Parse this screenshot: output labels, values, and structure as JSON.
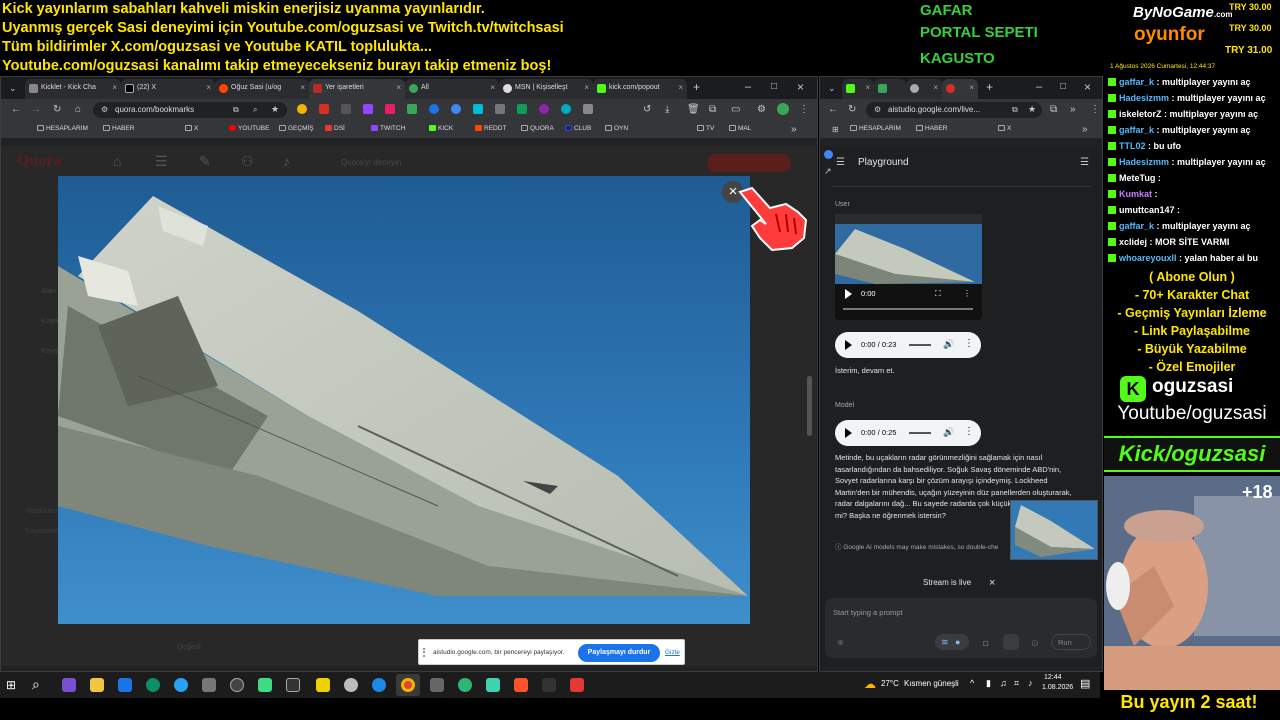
{
  "banner": {
    "lines": [
      "Kick yayınlarım sabahları kahveli miskin enerjisiz uyanma yayınlarıdır.",
      "Uyanmış gerçek Sasi deneyimi için Youtube.com/oguzsasi ve Twitch.tv/twitchsasi",
      "Tüm bildirimler X.com/oguzsasi ve Youtube KATIL toplulukta...",
      "Youtube.com/oguzsasi kanalımı takip etmeyecekseniz burayı takip etmeniz boş!"
    ],
    "goals": [
      "GAFAR",
      "PORTAL SEPETI",
      "KAGUSTO"
    ]
  },
  "donations": {
    "brand_top": "ByNoGame",
    "brand_domain": ".com",
    "brand_bottom": "oyunfor",
    "amounts": [
      "TRY 30.00",
      "TRY 30.00",
      "TRY 31.00"
    ],
    "date": "1 Ağustos 2026 Cumartesi, 12:44:37"
  },
  "left_browser": {
    "tabs": [
      "Kicklet - Kick Cha",
      "(22) X",
      "Oğuz Sasi (u/og",
      "Yer işaretleri",
      "All",
      "MSN | Kişiselleşt",
      "kick.com/popout"
    ],
    "url": "quora.com/bookmarks",
    "bookmarks": [
      "HESAPLARIM",
      "HABER",
      "X",
      "YOUTUBE",
      "GEÇMİŞ",
      "DSİ",
      "TWITCH",
      "KICK",
      "REDDT",
      "QUORA",
      "CLUB",
      "OYN",
      "TV",
      "MAL"
    ],
    "search_placeholder": "Quora'yı deneyin",
    "sidebar_items": [
      "Alan",
      "Koleksi",
      "Kaydedi",
      "Yazdıklarınız",
      "Kaydedildi"
    ],
    "footer_action": "Değerli"
  },
  "right_browser": {
    "url": "aistudio.google.com/live...",
    "bookmarks": [
      "HESAPLARIM",
      "HABER",
      "X"
    ],
    "title": "Playground",
    "user_label": "User",
    "video_time": "0:00",
    "audio1_time": "0:00 / 0:23",
    "user_message": "İsterim, devam et.",
    "model_label": "Model",
    "audio2_time": "0:00 / 0:25",
    "model_message": "Metinde, bu uçakların radar görünmezliğini sağlamak için nasıl tasarlandığından da bahsediliyor. Soğuk Savaş döneminde ABD'nin, Sovyet radarlarına karşı bir çözüm arayışı içindeymiş. Lockheed Martin'den bir mühendis, uçağın yüzeyinin düz panellerden oluşturarak, radar dalgalarını dağ... Bu sayede radarda çok küçük bir iz bırakıyorl... mi? Başka ne öğrenmek istersin?",
    "disclaimer": "Google AI models may make mistakes, so double-che",
    "stream_status": "Stream is live",
    "prompt_placeholder": "Start typing a prompt",
    "run_label": "Run"
  },
  "share_bar": {
    "text": "aistudio.google.com, bir pencereyi paylaşıyor.",
    "stop_button": "Paylaşmayı durdur",
    "hide_link": "Gizle"
  },
  "chat": [
    {
      "user": "gaffar_k",
      "msg": "multiplayer yayını aç",
      "color": "#53b8ff"
    },
    {
      "user": "Hadesizmm",
      "msg": "multiplayer yayını aç",
      "color": "#53b8ff"
    },
    {
      "user": "iskeletorZ",
      "msg": "multiplayer yayını aç",
      "color": "#ffffff"
    },
    {
      "user": "gaffar_k",
      "msg": "multiplayer yayını aç",
      "color": "#53b8ff"
    },
    {
      "user": "TTL02",
      "msg": "bu ufo",
      "color": "#53b8ff"
    },
    {
      "user": "Hadesizmm",
      "msg": "multiplayer yayını aç",
      "color": "#53b8ff"
    },
    {
      "user": "MeteTug",
      "msg": "",
      "color": "#ffffff"
    },
    {
      "user": "Kumkat",
      "msg": "",
      "color": "#c77dff"
    },
    {
      "user": "umuttcan147",
      "msg": "",
      "color": "#ffffff"
    },
    {
      "user": "gaffar_k",
      "msg": "multiplayer yayını aç",
      "color": "#53b8ff"
    },
    {
      "user": "xclidej",
      "msg": "MOR SİTE VARMI",
      "color": "#ffffff"
    },
    {
      "user": "whoareyouxll",
      "msg": "yalan haber ai bu",
      "color": "#53b8ff"
    }
  ],
  "perks": [
    "( Abone Olun )",
    "- 70+ Karakter Chat",
    "- Geçmiş Yayınları İzleme",
    "- Link Paylaşabilme",
    "- Büyük Yazabilme",
    "- Özel Emojiler"
  ],
  "socials": {
    "kick_name": "oguzsasi",
    "youtube": "Youtube/oguzsasi",
    "kick": "Kick/oguzsasi",
    "viewer_badge": "+18",
    "bottom": "Bu yayın 2 saat!"
  },
  "taskbar": {
    "weather": "27°C",
    "weather_desc": "Kısmen güneşli",
    "time": "12:44",
    "date": "1.08.2026"
  },
  "colors": {
    "banner_yellow": "#ffe600",
    "goal_green": "#35d03a",
    "kick_green": "#53fc18",
    "share_blue": "#1a73e8"
  }
}
